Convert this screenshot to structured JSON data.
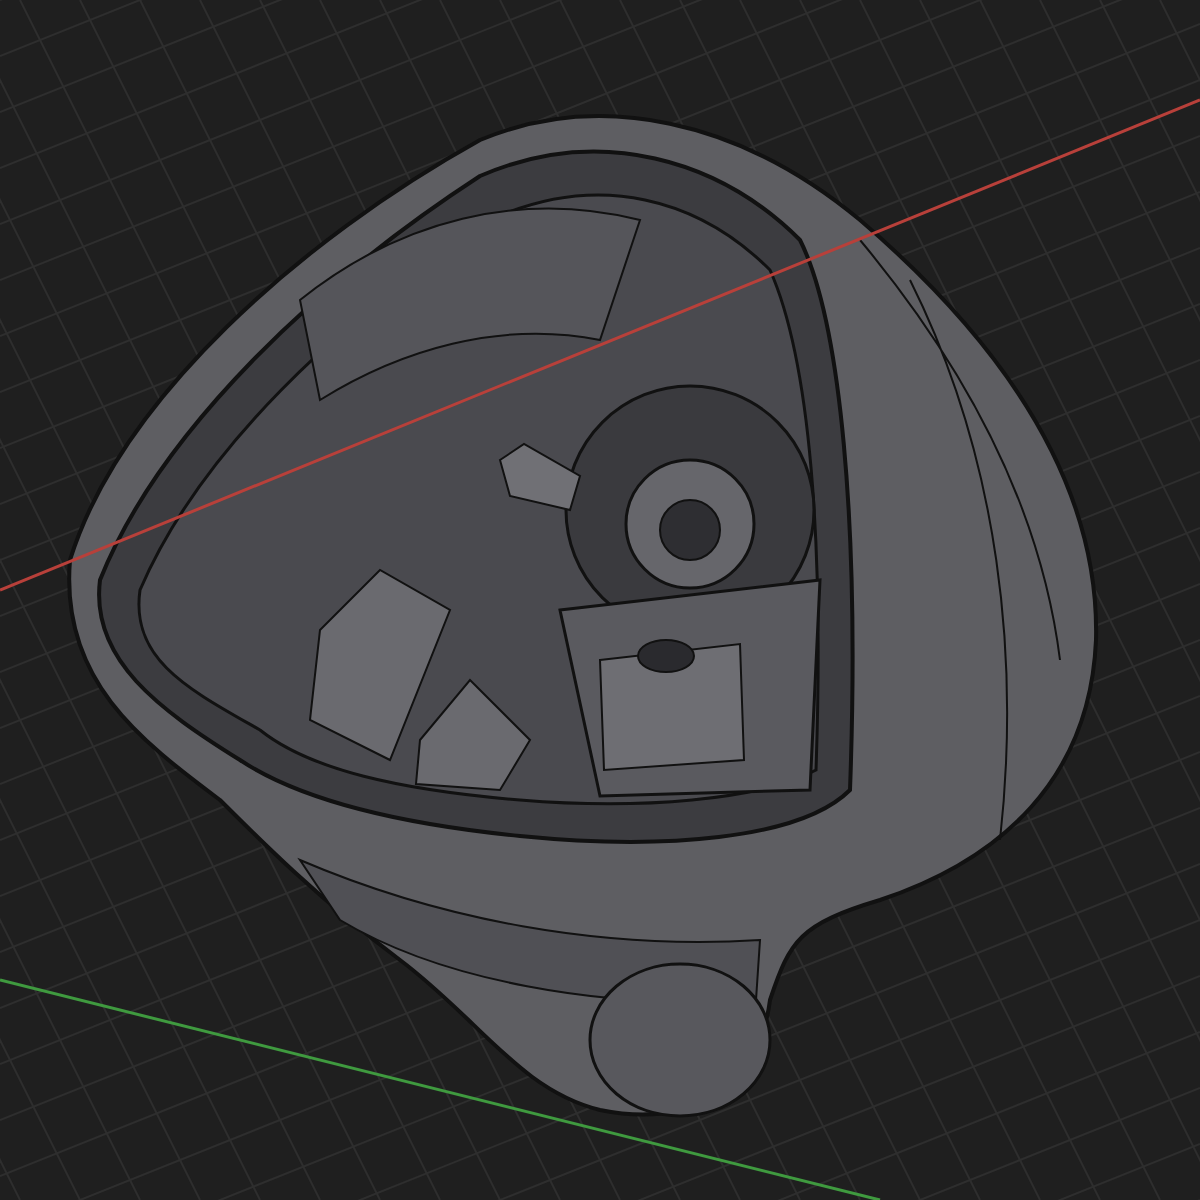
{
  "axes": [
    {
      "color": "#b8403a"
    },
    {
      "color": "#3f9a3f"
    }
  ]
}
